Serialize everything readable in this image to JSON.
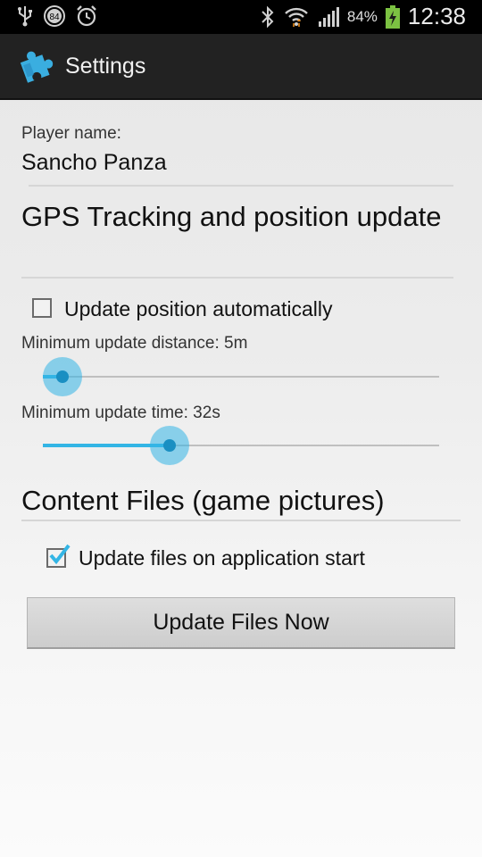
{
  "status_bar": {
    "notification_badge": "84",
    "battery_percent": "84%",
    "time": "12:38",
    "icons": [
      "usb-icon",
      "notification-badge-icon",
      "alarm-icon",
      "bluetooth-icon",
      "wifi-icon",
      "signal-icon",
      "battery-charging-icon"
    ]
  },
  "action_bar": {
    "title": "Settings",
    "icon": "puzzle-piece-icon"
  },
  "player": {
    "label": "Player name:",
    "value": "Sancho Panza"
  },
  "gps_section": {
    "title": "GPS Tracking and position update",
    "auto_update_label": "Update position automatically",
    "auto_update_checked": false,
    "distance_label": "Minimum update distance: 5m",
    "distance_level": 0.05,
    "time_label": "Minimum update time: 32s",
    "time_level": 0.32
  },
  "content_section": {
    "title": "Content Files (game pictures)",
    "update_on_start_label": "Update files on application start",
    "update_on_start_checked": true,
    "update_now_button": "Update Files Now"
  },
  "colors": {
    "accent": "#33b5e5",
    "action_bar": "#222222",
    "status_bar": "#000000"
  }
}
